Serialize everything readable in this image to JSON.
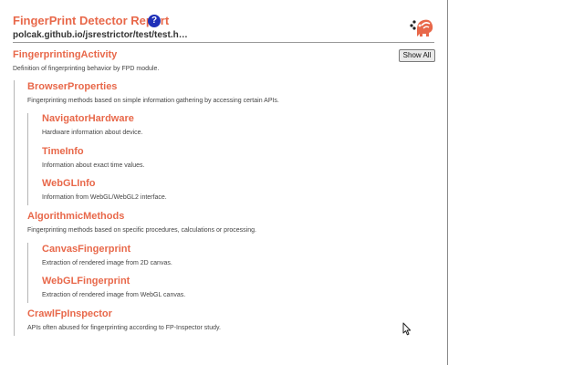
{
  "header": {
    "title": "FingerPrint Detector Report",
    "help_icon": "?",
    "url": "polcak.github.io/jsrestrictor/test/test.h…",
    "logo_icon": "jshelter-logo-icon"
  },
  "toolbar": {
    "show_all_label": "Show All"
  },
  "groups": {
    "fingerprinting_activity": {
      "title": "FingerprintingActivity",
      "description": "Definition of fingerprinting behavior by FPD module."
    },
    "browser_properties": {
      "title": "BrowserProperties",
      "description": "Fingerprinting methods based on simple information gathering by accessing certain APIs."
    },
    "navigator_hardware": {
      "title": "NavigatorHardware",
      "description": "Hardware information about device."
    },
    "time_info": {
      "title": "TimeInfo",
      "description": "Information about exact time values."
    },
    "webgl_info": {
      "title": "WebGLInfo",
      "description": "Information from WebGL/WebGL2 interface."
    },
    "algorithmic_methods": {
      "title": "AlgorithmicMethods",
      "description": "Fingerprinting methods based on specific procedures, calculations or processing."
    },
    "canvas_fingerprint": {
      "title": "CanvasFingerprint",
      "description": "Extraction of rendered image from 2D canvas."
    },
    "webgl_fingerprint": {
      "title": "WebGLFingerprint",
      "description": "Extraction of rendered image from WebGL canvas."
    },
    "crawl_fp_inspector": {
      "title": "CrawlFpInspector",
      "description": "APIs often abused for fingerprinting according to FP-Inspector study."
    }
  },
  "colors": {
    "accent": "#e8684a",
    "help_badge": "#1f2fb8",
    "text": "#444444"
  }
}
